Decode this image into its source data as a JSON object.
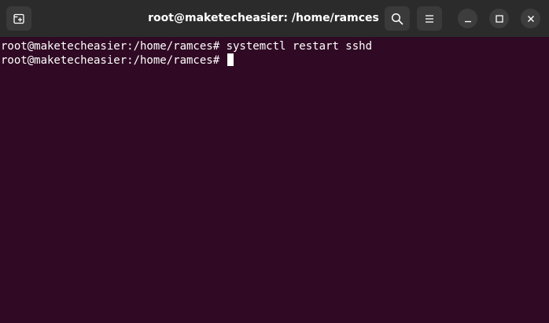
{
  "window": {
    "title": "root@maketecheasier: /home/ramces"
  },
  "headerbar": {
    "buttons": [
      {
        "name": "new-tab",
        "icon": "new-tab-icon"
      },
      {
        "name": "search",
        "icon": "search-icon"
      },
      {
        "name": "menu",
        "icon": "hamburger-menu-icon"
      }
    ],
    "window_controls": [
      {
        "name": "minimize",
        "icon": "minimize-icon"
      },
      {
        "name": "maximize",
        "icon": "maximize-icon"
      },
      {
        "name": "close",
        "icon": "close-icon"
      }
    ]
  },
  "terminal": {
    "lines": [
      {
        "prompt": "root@maketecheasier:/home/ramces# ",
        "command": "systemctl restart sshd"
      },
      {
        "prompt": "root@maketecheasier:/home/ramces# ",
        "command": ""
      }
    ]
  },
  "colors": {
    "terminal_background": "#300a24",
    "headerbar_background": "#2b2b2b",
    "text": "#ffffff"
  }
}
